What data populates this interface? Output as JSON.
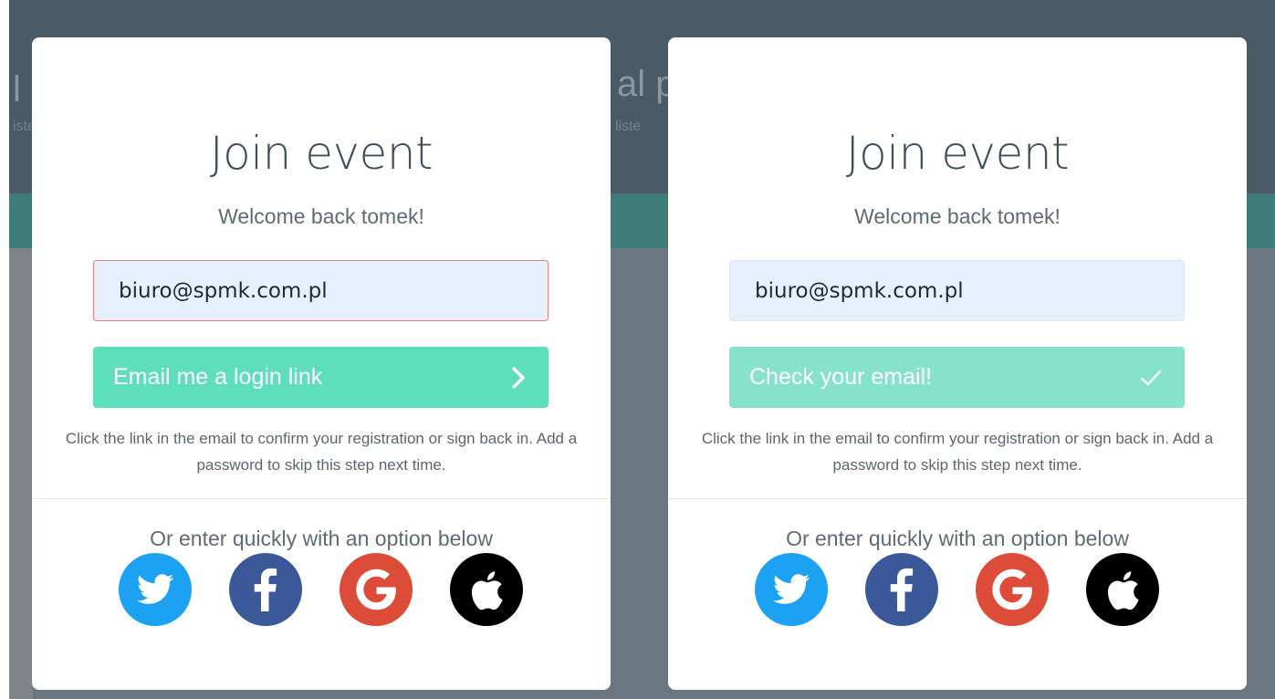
{
  "background": {
    "fragment_left": "l p",
    "fragment_mid": "al p",
    "fragment_small_1": "iste",
    "fragment_small_2": "liste"
  },
  "panels": [
    {
      "title": "Join event",
      "welcome": "Welcome back tomek!",
      "email_value": "biuro@spmk.com.pl",
      "button_label": "Email me a login link",
      "button_icon": "chevron-right-icon",
      "hint": "Click the link in the email to confirm your registration or sign back in. Add a password to skip this step next time.",
      "or_text": "Or enter quickly with an option below"
    },
    {
      "title": "Join event",
      "welcome": "Welcome back tomek!",
      "email_value": "biuro@spmk.com.pl",
      "button_label": "Check your email!",
      "button_icon": "checkmark-icon",
      "hint": "Click the link in the email to confirm your registration or sign back in. Add a password to skip this step next time.",
      "or_text": "Or enter quickly with an option below"
    }
  ],
  "social_colors": {
    "twitter": "#1da1f2",
    "facebook": "#3b5998",
    "google": "#dd4b39",
    "apple": "#000000"
  },
  "social_icons": [
    "twitter-icon",
    "facebook-icon",
    "google-icon",
    "apple-icon"
  ],
  "colors": {
    "cta_active": "#5fdfb9",
    "cta_done": "#86e3c9",
    "input_bg": "#e8effc",
    "input_error_border": "#e07f7f",
    "title_text": "#3f4f5c"
  }
}
